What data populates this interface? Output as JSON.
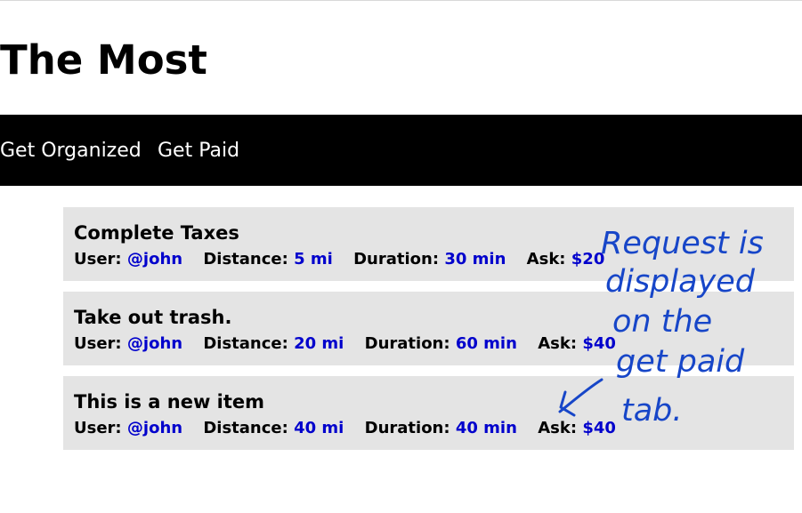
{
  "app": {
    "title": "The Most"
  },
  "nav": {
    "items": [
      {
        "label": "Get Organized"
      },
      {
        "label": "Get Paid"
      }
    ]
  },
  "meta_labels": {
    "user": "User:",
    "distance": "Distance:",
    "duration": "Duration:",
    "ask": "Ask:"
  },
  "requests": [
    {
      "title": "Complete Taxes",
      "user": "@john",
      "distance": "5 mi",
      "duration": "30 min",
      "ask": "$20"
    },
    {
      "title": "Take out trash.",
      "user": "@john",
      "distance": "20 mi",
      "duration": "60 min",
      "ask": "$40"
    },
    {
      "title": "This is a new item",
      "user": "@john",
      "distance": "40 mi",
      "duration": "40 min",
      "ask": "$40"
    }
  ],
  "annotation": {
    "lines": [
      "Request is",
      "displayed",
      "on the",
      "get paid",
      "tab."
    ]
  },
  "colors": {
    "navbar_bg": "#000000",
    "card_bg": "#e4e4e4",
    "value_blue": "#0000cc",
    "annotation_blue": "#1746c8"
  }
}
